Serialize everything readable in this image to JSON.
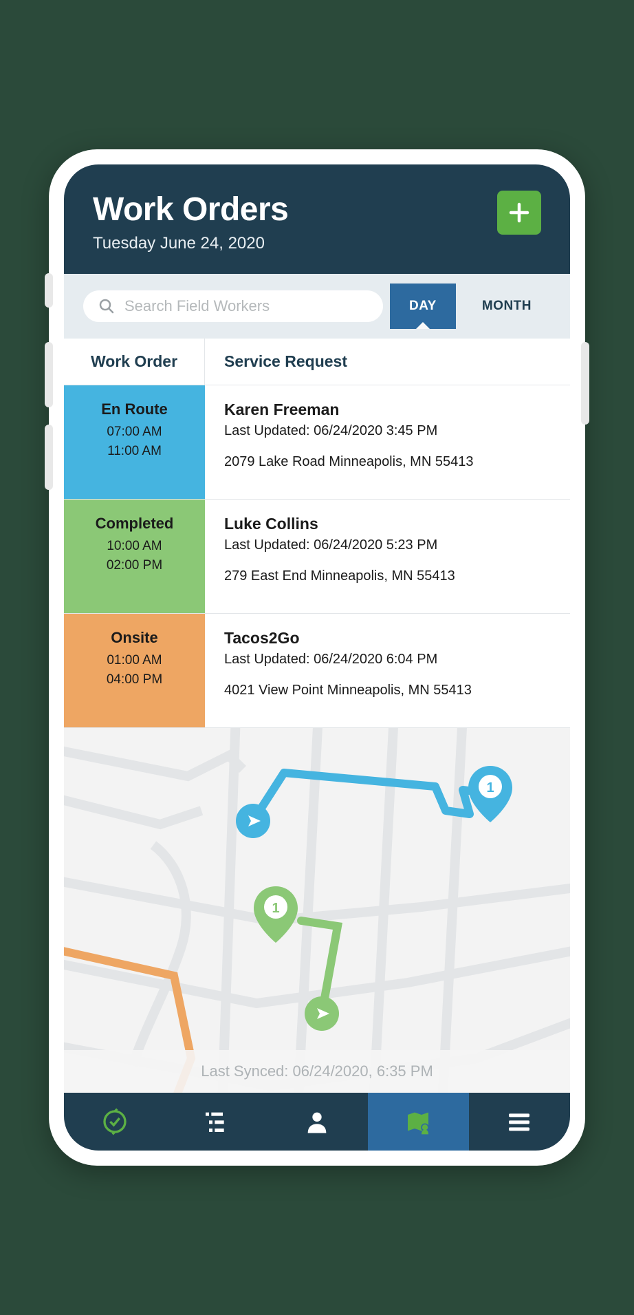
{
  "header": {
    "title": "Work Orders",
    "subtitle": "Tuesday June 24, 2020"
  },
  "search": {
    "placeholder": "Search Field Workers"
  },
  "tabs": {
    "day": "DAY",
    "month": "MONTH"
  },
  "columns": {
    "work_order": "Work Order",
    "service_request": "Service  Request"
  },
  "orders": [
    {
      "status": "En Route",
      "start": "07:00 AM",
      "end": "11:00 AM",
      "name": "Karen Freeman",
      "updated": "Last Updated: 06/24/2020  3:45 PM",
      "address": "2079 Lake Road Minneapolis, MN 55413",
      "status_class": "status-en"
    },
    {
      "status": "Completed",
      "start": "10:00 AM",
      "end": "02:00 PM",
      "name": "Luke Collins",
      "updated": "Last Updated: 06/24/2020  5:23 PM",
      "address": "279 East End Minneapolis, MN 55413",
      "status_class": "status-comp"
    },
    {
      "status": "Onsite",
      "start": "01:00 AM",
      "end": "04:00 PM",
      "name": "Tacos2Go",
      "updated": "Last Updated: 06/24/2020  6:04 PM",
      "address": "4021 View Point Minneapolis, MN 55413",
      "status_class": "status-on"
    }
  ],
  "map": {
    "markers": [
      "1",
      "1"
    ]
  },
  "sync": {
    "label": "Last Synced: 06/24/2020, 6:35 PM"
  },
  "colors": {
    "en_route": "#45b4e0",
    "completed": "#8bc876",
    "onsite": "#eea663",
    "header": "#203e50",
    "accent": "#2d6a9f",
    "add": "#5cb044"
  }
}
